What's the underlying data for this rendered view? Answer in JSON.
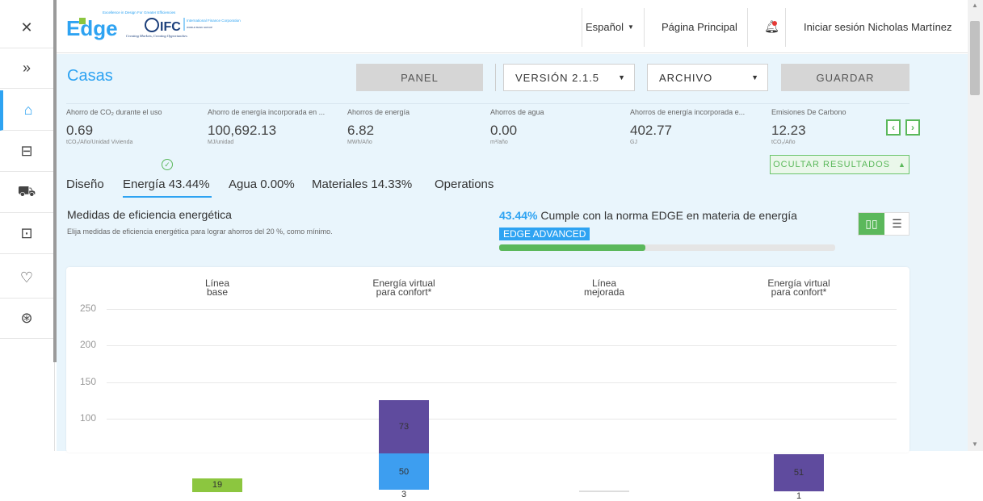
{
  "rail": {
    "items": [
      {
        "icon": "close-icon",
        "glyph": "✕"
      },
      {
        "icon": "expand-icon",
        "glyph": "»"
      },
      {
        "icon": "home-icon",
        "glyph": "⌂"
      },
      {
        "icon": "bed-icon",
        "glyph": "⊟"
      },
      {
        "icon": "cart-icon",
        "glyph": "⛟"
      },
      {
        "icon": "briefcase-icon",
        "glyph": "⊡"
      },
      {
        "icon": "heart-icon",
        "glyph": "♡"
      },
      {
        "icon": "graduation-cap-icon",
        "glyph": "⊛"
      }
    ]
  },
  "header": {
    "logo_tagline": "Excellence in Design For Greater Efficiencies",
    "logo_text": "Edge",
    "ifc_name": "IFC",
    "ifc_full": "International Finance Corporation",
    "ifc_group": "WORLD BANK GROUP",
    "ifc_slogan": "Creating Markets, Creating Opportunities",
    "language": "Español",
    "home": "Página Principal",
    "login": "Iniciar sesión",
    "user": "Nicholas Martínez"
  },
  "toolbar": {
    "title": "Casas",
    "panel": "PANEL",
    "version": "VERSIÓN 2.1.5",
    "archivo": "ARCHIVO",
    "guardar": "GUARDAR"
  },
  "metrics": [
    {
      "label": "Ahorro de CO₂ durante el uso",
      "value": "0.69",
      "unit": "tCO₂/Año/Unidad Vivienda"
    },
    {
      "label": "Ahorro de energía incorporada en ...",
      "value": "100,692.13",
      "unit": "MJ/unidad"
    },
    {
      "label": "Ahorros de energía",
      "value": "6.82",
      "unit": "MWh/Año"
    },
    {
      "label": "Ahorros de agua",
      "value": "0.00",
      "unit": "m³/año"
    },
    {
      "label": "Ahorros de energía incorporada e...",
      "value": "402.77",
      "unit": "GJ"
    },
    {
      "label": "Emisiones De Carbono",
      "value": "12.23",
      "unit": "tCO₂/Año"
    }
  ],
  "ocultar": "OCULTAR RESULTADOS",
  "tabs": [
    "Diseño",
    "Energía 43.44%",
    "Agua 0.00%",
    "Materiales 14.33%",
    "Operations"
  ],
  "measures": {
    "title": "Medidas de eficiencia energética",
    "subtitle": "Elija medidas de eficiencia energética para lograr ahorros del 20 %, como mínimo.",
    "percent": "43.44%",
    "percent_text": "Cumple con la norma EDGE en materia de energía",
    "badge": "EDGE ADVANCED",
    "progress": 0.4344
  },
  "colors": {
    "accent": "#2ea3f2",
    "green": "#5bb85b",
    "purple": "#5f4b9e",
    "blue": "#3d9ef0",
    "lime": "#8cc63f"
  },
  "chart_data": {
    "type": "bar",
    "categories": [
      "Línea base",
      "Energía virtual para confort*",
      "Línea mejorada",
      "Energía virtual para confort*"
    ],
    "headers": [
      [
        "Línea",
        "base"
      ],
      [
        "Energía virtual",
        "para confort*"
      ],
      [
        "Línea",
        "mejorada"
      ],
      [
        "Energía virtual",
        "para confort*"
      ]
    ],
    "yticks": [
      250,
      200,
      150,
      100
    ],
    "ylim": [
      0,
      250
    ],
    "segments": [
      {
        "cat": 0,
        "from": 0,
        "to": 19,
        "label": "19",
        "color": "#8cc63f"
      },
      {
        "cat": 1,
        "from": 0,
        "to": 3,
        "label": "3",
        "color": "#ffffff"
      },
      {
        "cat": 1,
        "from": 3,
        "to": 53,
        "label": "50",
        "color": "#3d9ef0"
      },
      {
        "cat": 1,
        "from": 53,
        "to": 126,
        "label": "73",
        "color": "#5f4b9e"
      },
      {
        "cat": 2,
        "from": 0,
        "to": 2,
        "label": "",
        "color": "#dddddd"
      },
      {
        "cat": 3,
        "from": 0,
        "to": 1,
        "label": "1",
        "color": "#ffffff"
      },
      {
        "cat": 3,
        "from": 1,
        "to": 52,
        "label": "51",
        "color": "#5f4b9e"
      }
    ]
  }
}
